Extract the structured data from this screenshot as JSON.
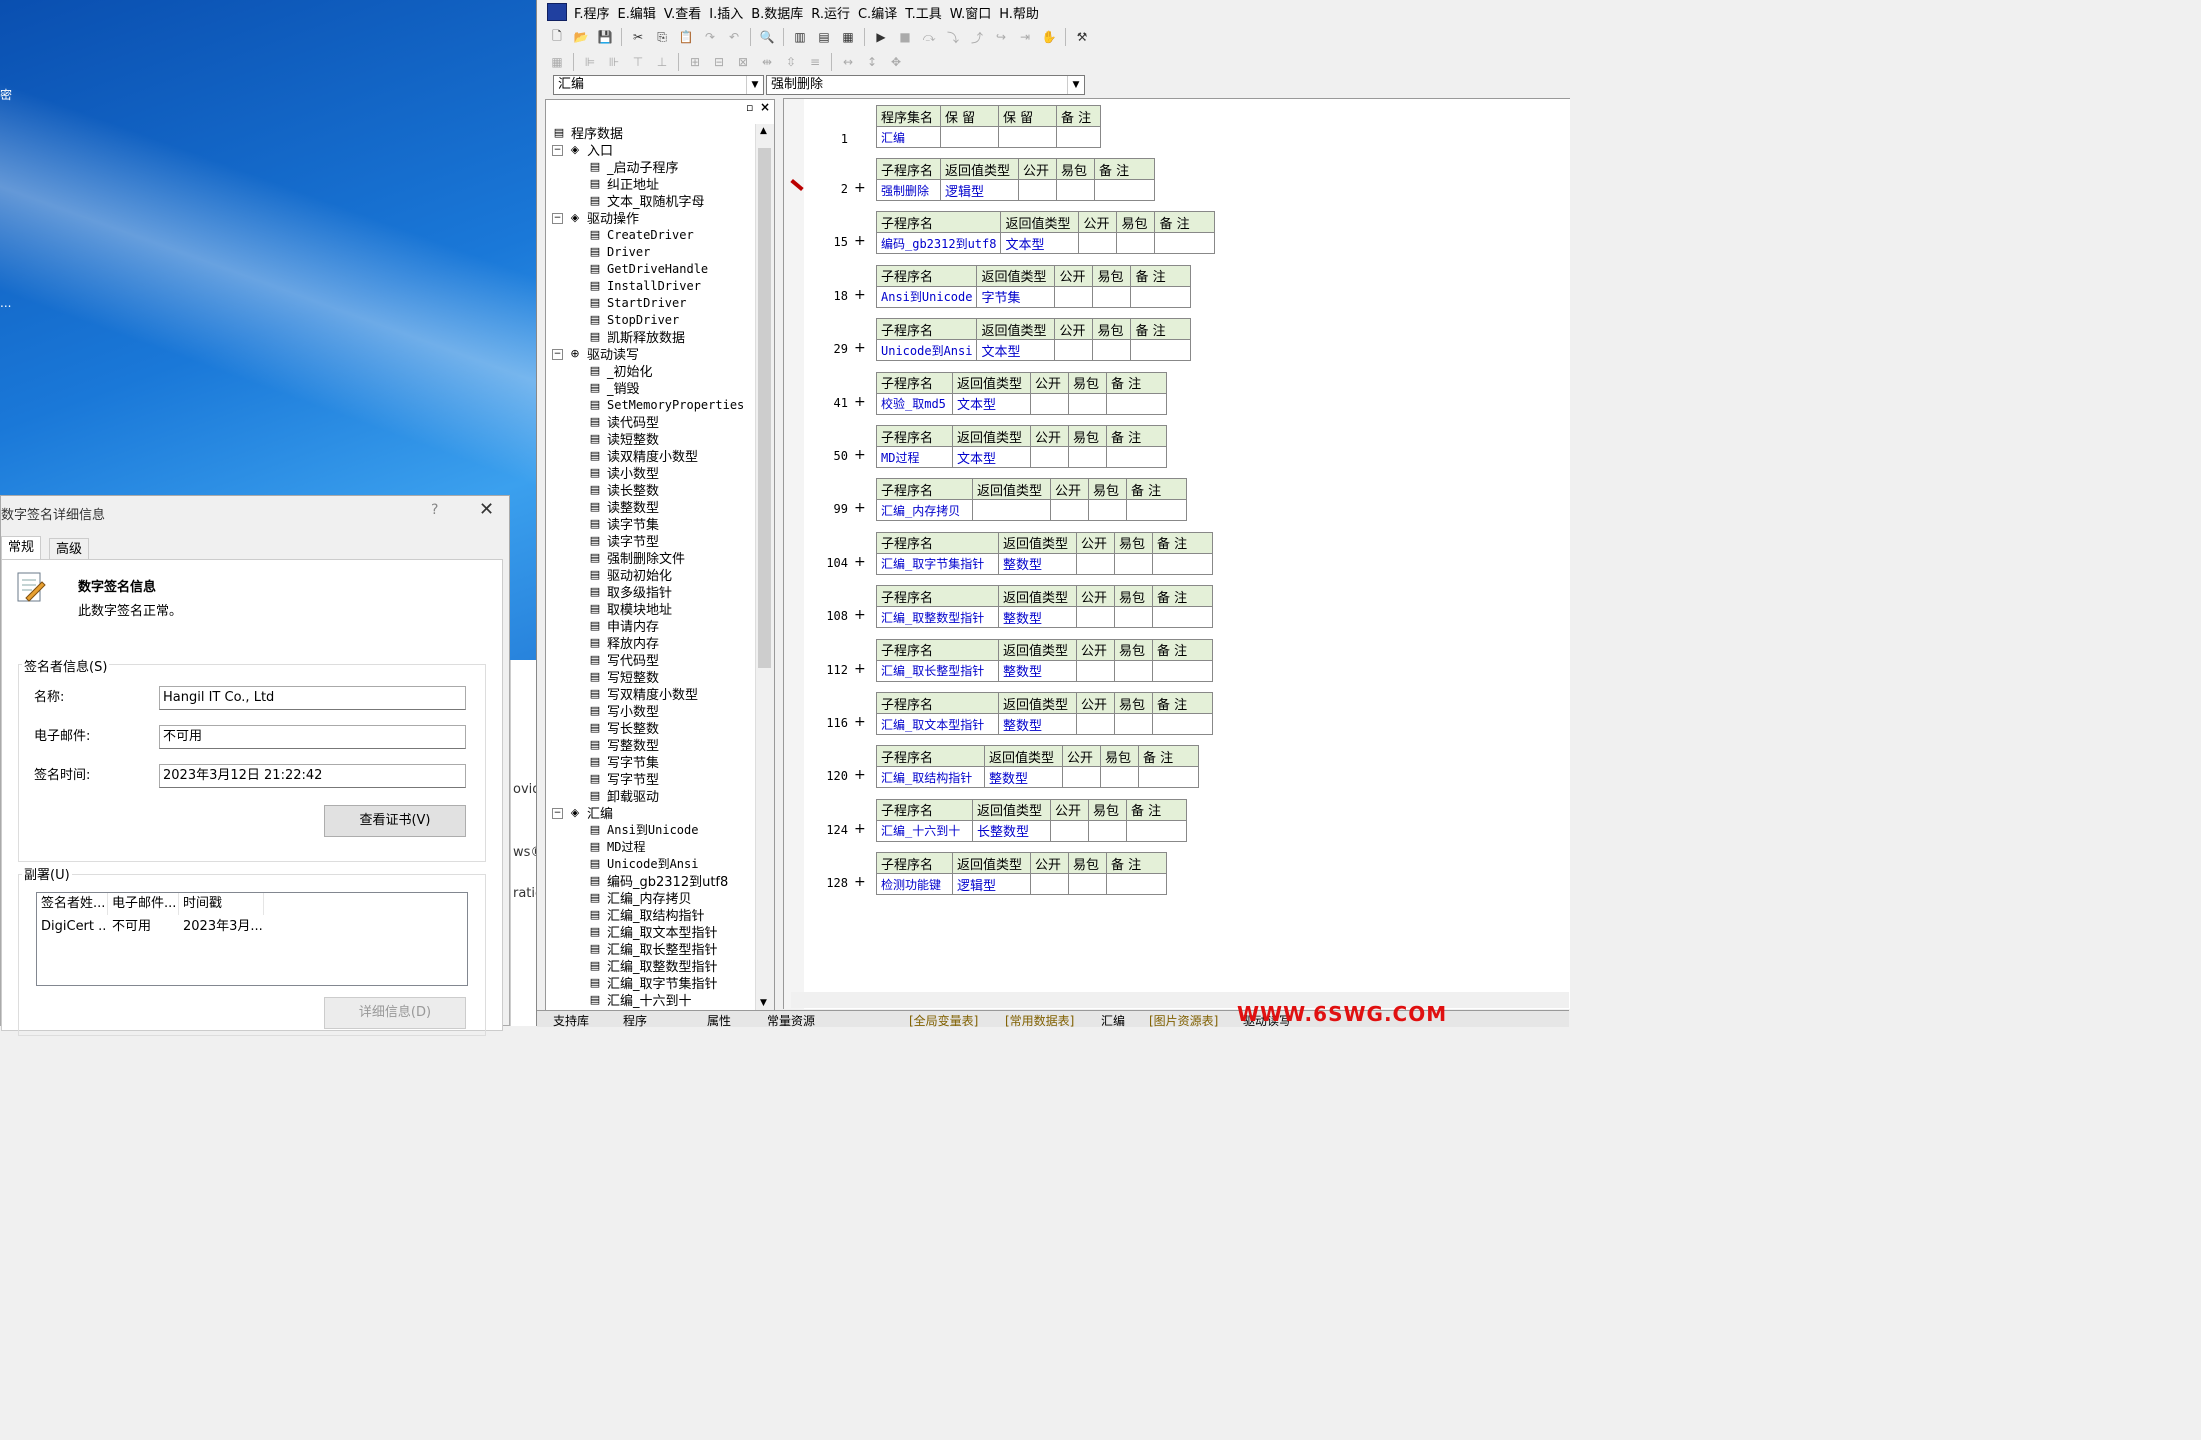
{
  "desktop": {
    "edge_text_1": "密",
    "edge_text_2": "..."
  },
  "behind_window": {
    "t1": "ovid",
    "t2": "ws®",
    "t3": "ratio"
  },
  "ide": {
    "menu": [
      "F.程序",
      "E.编辑",
      "V.查看",
      "I.插入",
      "B.数据库",
      "R.运行",
      "C.编译",
      "T.工具",
      "W.窗口",
      "H.帮助"
    ],
    "combo_left": "汇编",
    "combo_right": "强制删除",
    "tree": [
      {
        "label": "程序数据",
        "level": 0,
        "icon": "program-data-icon",
        "toggle": ""
      },
      {
        "label": "入口",
        "level": 1,
        "icon": "module-icon",
        "toggle": "−"
      },
      {
        "label": "_启动子程序",
        "level": 2,
        "icon": "sub-icon",
        "toggle": ""
      },
      {
        "label": "纠正地址",
        "level": 2,
        "icon": "sub-icon",
        "toggle": ""
      },
      {
        "label": "文本_取随机字母",
        "level": 2,
        "icon": "sub-icon",
        "toggle": ""
      },
      {
        "label": "驱动操作",
        "level": 1,
        "icon": "module-icon",
        "toggle": "−"
      },
      {
        "label": "CreateDriver",
        "level": 2,
        "icon": "sub-icon",
        "toggle": ""
      },
      {
        "label": "Driver",
        "level": 2,
        "icon": "sub-icon",
        "toggle": ""
      },
      {
        "label": "GetDriveHandle",
        "level": 2,
        "icon": "sub-icon",
        "toggle": ""
      },
      {
        "label": "InstallDriver",
        "level": 2,
        "icon": "sub-icon",
        "toggle": ""
      },
      {
        "label": "StartDriver",
        "level": 2,
        "icon": "sub-icon",
        "toggle": ""
      },
      {
        "label": "StopDriver",
        "level": 2,
        "icon": "sub-icon",
        "toggle": ""
      },
      {
        "label": "凯斯释放数据",
        "level": 2,
        "icon": "sub-icon",
        "toggle": ""
      },
      {
        "label": "驱动读写",
        "level": 1,
        "icon": "class-icon",
        "toggle": "−"
      },
      {
        "label": "_初始化",
        "level": 2,
        "icon": "sub-icon",
        "toggle": ""
      },
      {
        "label": "_销毁",
        "level": 2,
        "icon": "sub-icon",
        "toggle": ""
      },
      {
        "label": "SetMemoryProperties",
        "level": 2,
        "icon": "sub-icon",
        "toggle": ""
      },
      {
        "label": "读代码型",
        "level": 2,
        "icon": "sub-icon",
        "toggle": ""
      },
      {
        "label": "读短整数",
        "level": 2,
        "icon": "sub-icon",
        "toggle": ""
      },
      {
        "label": "读双精度小数型",
        "level": 2,
        "icon": "sub-icon",
        "toggle": ""
      },
      {
        "label": "读小数型",
        "level": 2,
        "icon": "sub-icon",
        "toggle": ""
      },
      {
        "label": "读长整数",
        "level": 2,
        "icon": "sub-icon",
        "toggle": ""
      },
      {
        "label": "读整数型",
        "level": 2,
        "icon": "sub-icon",
        "toggle": ""
      },
      {
        "label": "读字节集",
        "level": 2,
        "icon": "sub-icon",
        "toggle": ""
      },
      {
        "label": "读字节型",
        "level": 2,
        "icon": "sub-icon",
        "toggle": ""
      },
      {
        "label": "强制删除文件",
        "level": 2,
        "icon": "sub-icon",
        "toggle": ""
      },
      {
        "label": "驱动初始化",
        "level": 2,
        "icon": "sub-icon",
        "toggle": ""
      },
      {
        "label": "取多级指针",
        "level": 2,
        "icon": "sub-icon",
        "toggle": ""
      },
      {
        "label": "取模块地址",
        "level": 2,
        "icon": "sub-icon",
        "toggle": ""
      },
      {
        "label": "申请内存",
        "level": 2,
        "icon": "sub-icon",
        "toggle": ""
      },
      {
        "label": "释放内存",
        "level": 2,
        "icon": "sub-icon",
        "toggle": ""
      },
      {
        "label": "写代码型",
        "level": 2,
        "icon": "sub-icon",
        "toggle": ""
      },
      {
        "label": "写短整数",
        "level": 2,
        "icon": "sub-icon",
        "toggle": ""
      },
      {
        "label": "写双精度小数型",
        "level": 2,
        "icon": "sub-icon",
        "toggle": ""
      },
      {
        "label": "写小数型",
        "level": 2,
        "icon": "sub-icon",
        "toggle": ""
      },
      {
        "label": "写长整数",
        "level": 2,
        "icon": "sub-icon",
        "toggle": ""
      },
      {
        "label": "写整数型",
        "level": 2,
        "icon": "sub-icon",
        "toggle": ""
      },
      {
        "label": "写字节集",
        "level": 2,
        "icon": "sub-icon",
        "toggle": ""
      },
      {
        "label": "写字节型",
        "level": 2,
        "icon": "sub-icon",
        "toggle": ""
      },
      {
        "label": "卸载驱动",
        "level": 2,
        "icon": "sub-icon",
        "toggle": ""
      },
      {
        "label": "汇编",
        "level": 1,
        "icon": "module-icon",
        "toggle": "−"
      },
      {
        "label": "Ansi到Unicode",
        "level": 2,
        "icon": "sub-icon",
        "toggle": ""
      },
      {
        "label": "MD过程",
        "level": 2,
        "icon": "sub-icon",
        "toggle": ""
      },
      {
        "label": "Unicode到Ansi",
        "level": 2,
        "icon": "sub-icon",
        "toggle": ""
      },
      {
        "label": "编码_gb2312到utf8",
        "level": 2,
        "icon": "sub-icon",
        "toggle": ""
      },
      {
        "label": "汇编_内存拷贝",
        "level": 2,
        "icon": "sub-icon",
        "toggle": ""
      },
      {
        "label": "汇编_取结构指针",
        "level": 2,
        "icon": "sub-icon",
        "toggle": ""
      },
      {
        "label": "汇编_取文本型指针",
        "level": 2,
        "icon": "sub-icon",
        "toggle": ""
      },
      {
        "label": "汇编_取长整型指针",
        "level": 2,
        "icon": "sub-icon",
        "toggle": ""
      },
      {
        "label": "汇编_取整数型指针",
        "level": 2,
        "icon": "sub-icon",
        "toggle": ""
      },
      {
        "label": "汇编_取字节集指针",
        "level": 2,
        "icon": "sub-icon",
        "toggle": ""
      },
      {
        "label": "汇编_十六到十",
        "level": 2,
        "icon": "sub-icon",
        "toggle": ""
      }
    ],
    "assembly_header": {
      "cols": [
        "程序集名",
        "保 留",
        "保 留",
        "备 注"
      ],
      "line": "1",
      "name": "汇编"
    },
    "sub_header_cols": [
      "子程序名",
      "返回值类型",
      "公开",
      "易包",
      "备 注"
    ],
    "subs": [
      {
        "line": "2",
        "name": "强制删除",
        "ret": "逻辑型"
      },
      {
        "line": "15",
        "name": "编码_gb2312到utf8",
        "ret": "文本型"
      },
      {
        "line": "18",
        "name": "Ansi到Unicode",
        "ret": "字节集"
      },
      {
        "line": "29",
        "name": "Unicode到Ansi",
        "ret": "文本型"
      },
      {
        "line": "41",
        "name": "校验_取md5",
        "ret": "文本型"
      },
      {
        "line": "50",
        "name": "MD过程",
        "ret": "文本型"
      },
      {
        "line": "99",
        "name": "汇编_内存拷贝",
        "ret": ""
      },
      {
        "line": "104",
        "name": "汇编_取字节集指针",
        "ret": "整数型"
      },
      {
        "line": "108",
        "name": "汇编_取整数型指针",
        "ret": "整数型"
      },
      {
        "line": "112",
        "name": "汇编_取长整型指针",
        "ret": "整数型"
      },
      {
        "line": "116",
        "name": "汇编_取文本型指针",
        "ret": "整数型"
      },
      {
        "line": "120",
        "name": "汇编_取结构指针",
        "ret": "整数型"
      },
      {
        "line": "124",
        "name": "汇编_十六到十",
        "ret": "长整数型"
      },
      {
        "line": "128",
        "name": "检测功能键",
        "ret": "逻辑型"
      }
    ],
    "plus_glyph": "+",
    "bottom_tabs": [
      "支持库",
      "程序",
      "属性",
      "常量资源",
      "[全局变量表]",
      "[常用数据表]",
      "汇编",
      "[图片资源表]",
      "驱动读写"
    ],
    "watermark": "WWW.6SWG.COM",
    "panel_buttons": [
      "▫",
      "×"
    ]
  },
  "dialog": {
    "title": "数字签名详细信息",
    "help": "?",
    "close": "✕",
    "tabs": [
      "常规",
      "高级"
    ],
    "info_title": "数字签名信息",
    "info_status": "此数字签名正常。",
    "signer_group": "签名者信息(S)",
    "fields": [
      {
        "label": "名称:",
        "value": "Hangil IT Co., Ltd"
      },
      {
        "label": "电子邮件:",
        "value": "不可用"
      },
      {
        "label": "签名时间:",
        "value": "2023年3月12日 21:22:42"
      }
    ],
    "view_cert": "查看证书(V)",
    "countersig_group": "副署(U)",
    "list_headers": [
      "签名者姓...",
      "电子邮件...",
      "时间戳"
    ],
    "list_row": [
      "DigiCert ...",
      "不可用",
      "2023年3月..."
    ],
    "details_btn": "详细信息(D)"
  }
}
